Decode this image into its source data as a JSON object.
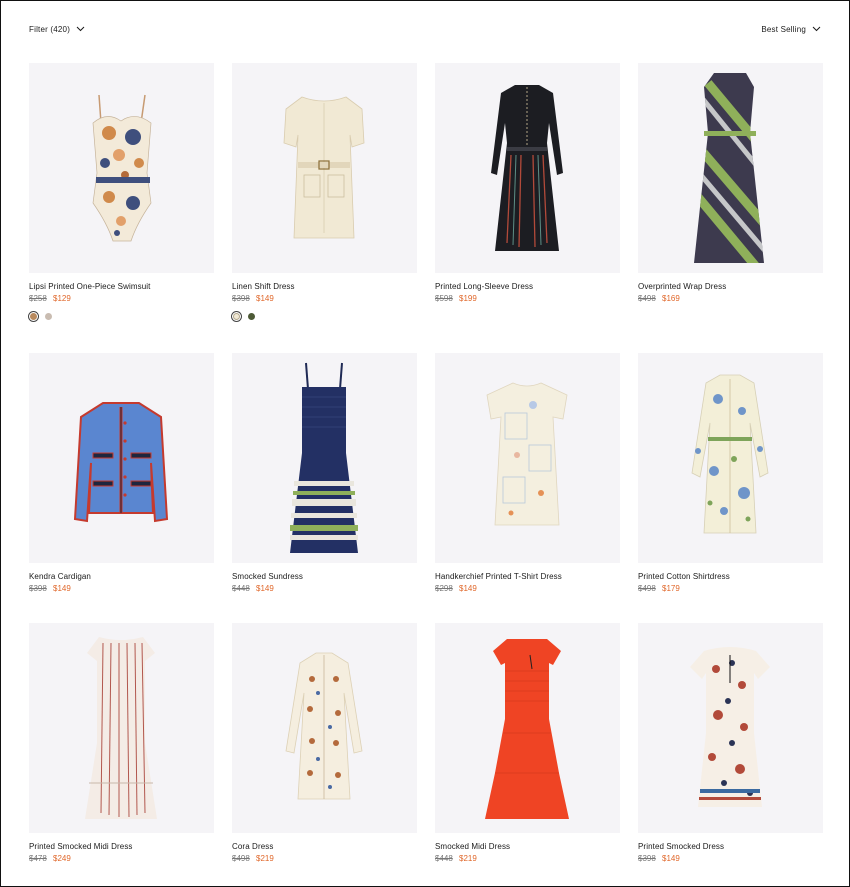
{
  "toolbar": {
    "filter_label": "Filter (420)",
    "sort_label": "Best Selling",
    "filter_icon": "chevron-down-icon",
    "sort_icon": "chevron-down-icon"
  },
  "products": [
    {
      "name": "Lipsi Printed One-Piece Swimsuit",
      "price_old": "$258",
      "price_sale": "$129",
      "swatches": [
        "#b98a5e",
        "#c9bcb1"
      ]
    },
    {
      "name": "Linen Shift Dress",
      "price_old": "$398",
      "price_sale": "$149",
      "swatches": [
        "#f1e9d4",
        "#4d5a36"
      ]
    },
    {
      "name": "Printed Long-Sleeve Dress",
      "price_old": "$598",
      "price_sale": "$199"
    },
    {
      "name": "Overprinted Wrap Dress",
      "price_old": "$498",
      "price_sale": "$169"
    },
    {
      "name": "Kendra Cardigan",
      "price_old": "$398",
      "price_sale": "$149"
    },
    {
      "name": "Smocked Sundress",
      "price_old": "$448",
      "price_sale": "$149"
    },
    {
      "name": "Handkerchief Printed T-Shirt Dress",
      "price_old": "$298",
      "price_sale": "$149"
    },
    {
      "name": "Printed Cotton Shirtdress",
      "price_old": "$498",
      "price_sale": "$179"
    },
    {
      "name": "Printed Smocked Midi Dress",
      "price_old": "$478",
      "price_sale": "$249"
    },
    {
      "name": "Cora Dress",
      "price_old": "$498",
      "price_sale": "$219"
    },
    {
      "name": "Smocked Midi Dress",
      "price_old": "$448",
      "price_sale": "$219"
    },
    {
      "name": "Printed Smocked Dress",
      "price_old": "$398",
      "price_sale": "$149"
    }
  ],
  "colors": {
    "sale": "#e0672a",
    "tile_bg": "#f5f4f7"
  }
}
